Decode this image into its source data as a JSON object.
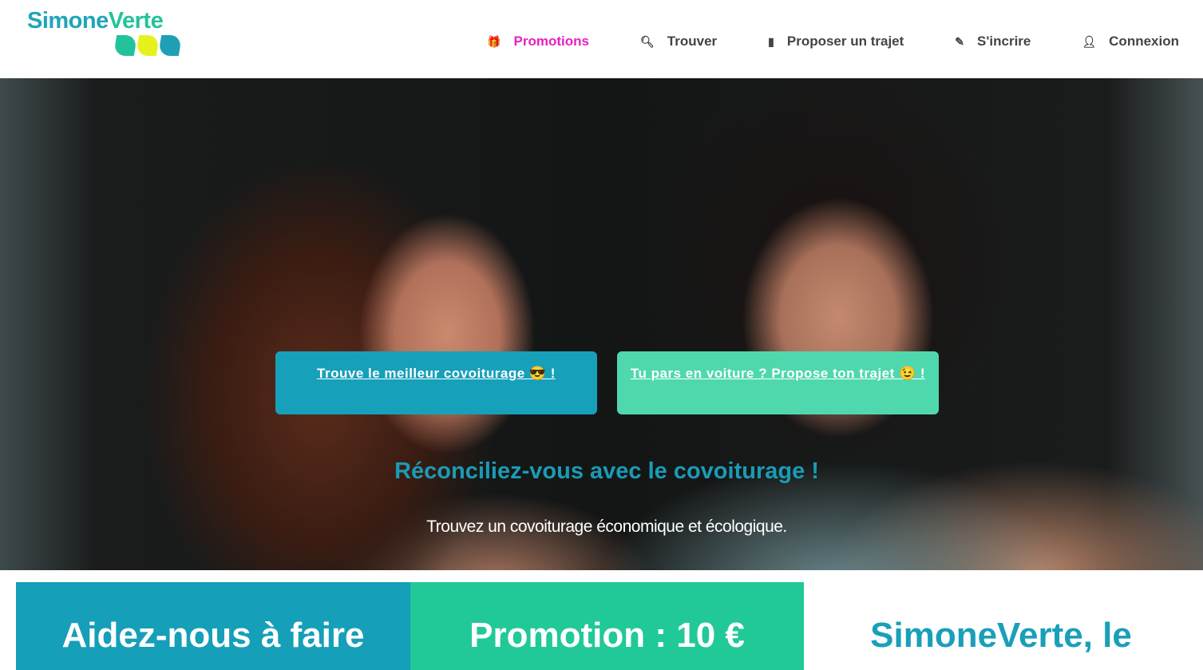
{
  "header": {
    "logo": {
      "part1": "Simone",
      "part2": "Verte",
      "leaf_colors": [
        "#22c39a",
        "#e6f21e",
        "#1f9fb6"
      ]
    },
    "nav": [
      {
        "label": "Promotions",
        "icon": "gift-icon",
        "glyph": "🎁",
        "active": true
      },
      {
        "label": "Trouver",
        "icon": "search-icon",
        "glyph": "🔍︎"
      },
      {
        "label": "Proposer un trajet",
        "icon": "map-icon",
        "glyph": "▮"
      },
      {
        "label": "S'incrire",
        "icon": "pencil-icon",
        "glyph": "✎"
      },
      {
        "label": "Connexion",
        "icon": "user-icon",
        "glyph": "👤︎"
      }
    ]
  },
  "hero": {
    "btn_find": "Trouve le meilleur covoiturage 😎 !",
    "btn_propose": "Tu pars en voiture ? Propose ton trajet 😉 !",
    "title": "Réconciliez-vous avec le covoiturage !",
    "subtitle": "Trouvez un covoiturage économique et écologique."
  },
  "cards": [
    "Aidez-nous à faire",
    "Promotion : 10 €",
    "SimoneVerte, le"
  ],
  "colors": {
    "accent": "#e620c4",
    "teal": "#17a0b9",
    "green": "#22c998"
  }
}
